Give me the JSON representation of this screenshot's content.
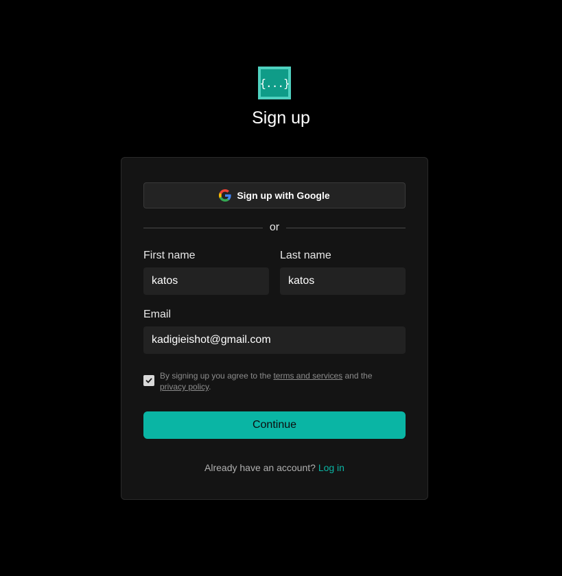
{
  "logo": {
    "glyph": "{...}"
  },
  "title": "Sign up",
  "google": {
    "label": "Sign up with Google",
    "icon": "google-icon"
  },
  "divider": {
    "text": "or"
  },
  "form": {
    "first_name": {
      "label": "First name",
      "value": "katos"
    },
    "last_name": {
      "label": "Last name",
      "value": "katos"
    },
    "email": {
      "label": "Email",
      "value": "kadigieishot@gmail.com"
    }
  },
  "terms": {
    "checked": true,
    "prefix": "By signing up you agree to the ",
    "terms_link": "terms and services",
    "middle": " and the",
    "privacy_link": "privacy policy",
    "suffix": "."
  },
  "continue_label": "Continue",
  "login": {
    "prompt": "Already have an account?",
    "link": "Log in"
  },
  "colors": {
    "background": "#000000",
    "card": "#141414",
    "accent": "#0ab5a4",
    "logo_fill": "#0f9c88",
    "logo_border": "#4fd1bf"
  }
}
